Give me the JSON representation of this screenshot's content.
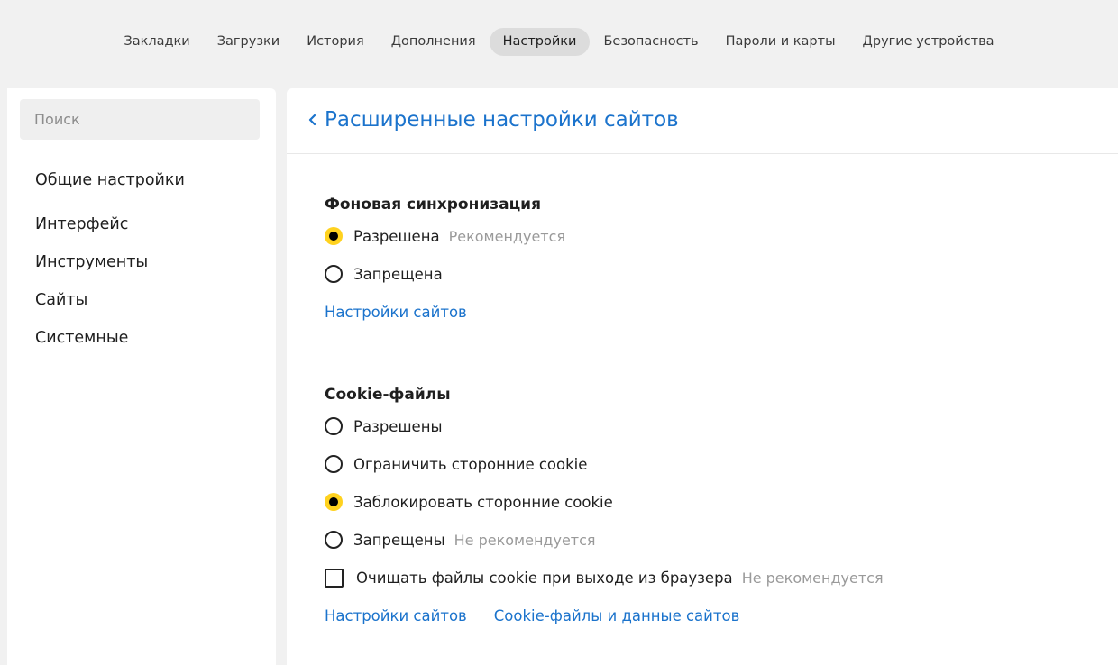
{
  "topnav": {
    "tabs": [
      {
        "label": "Закладки"
      },
      {
        "label": "Загрузки"
      },
      {
        "label": "История"
      },
      {
        "label": "Дополнения"
      },
      {
        "label": "Настройки",
        "active": true
      },
      {
        "label": "Безопасность"
      },
      {
        "label": "Пароли и карты"
      },
      {
        "label": "Другие устройства"
      }
    ]
  },
  "sidebar": {
    "search_placeholder": "Поиск",
    "items": [
      {
        "label": "Общие настройки"
      },
      {
        "label": "Интерфейс"
      },
      {
        "label": "Инструменты"
      },
      {
        "label": "Сайты"
      },
      {
        "label": "Системные"
      }
    ]
  },
  "main": {
    "back_icon": "chevron-left-icon",
    "title": "Расширенные настройки сайтов",
    "background_sync": {
      "title": "Фоновая синхронизация",
      "options": [
        {
          "label": "Разрешена",
          "note": "Рекомендуется",
          "selected": true
        },
        {
          "label": "Запрещена",
          "note": "",
          "selected": false
        }
      ],
      "link": "Настройки сайтов"
    },
    "cookies": {
      "title": "Cookie-файлы",
      "options": [
        {
          "label": "Разрешены",
          "note": "",
          "selected": false
        },
        {
          "label": "Ограничить сторонние cookie",
          "note": "",
          "selected": false
        },
        {
          "label": "Заблокировать сторонние cookie",
          "note": "",
          "selected": true
        },
        {
          "label": "Запрещены",
          "note": "Не рекомендуется",
          "selected": false
        }
      ],
      "clear_on_exit": {
        "label": "Очищать файлы cookie при выходе из браузера",
        "note": "Не рекомендуется",
        "checked": false
      },
      "links": [
        "Настройки сайтов",
        "Cookie-файлы и данные сайтов"
      ]
    }
  },
  "colors": {
    "accent_link": "#1b73cc",
    "radio_selected": "#ffd21f",
    "active_tab_bg": "#dcdcdc"
  }
}
